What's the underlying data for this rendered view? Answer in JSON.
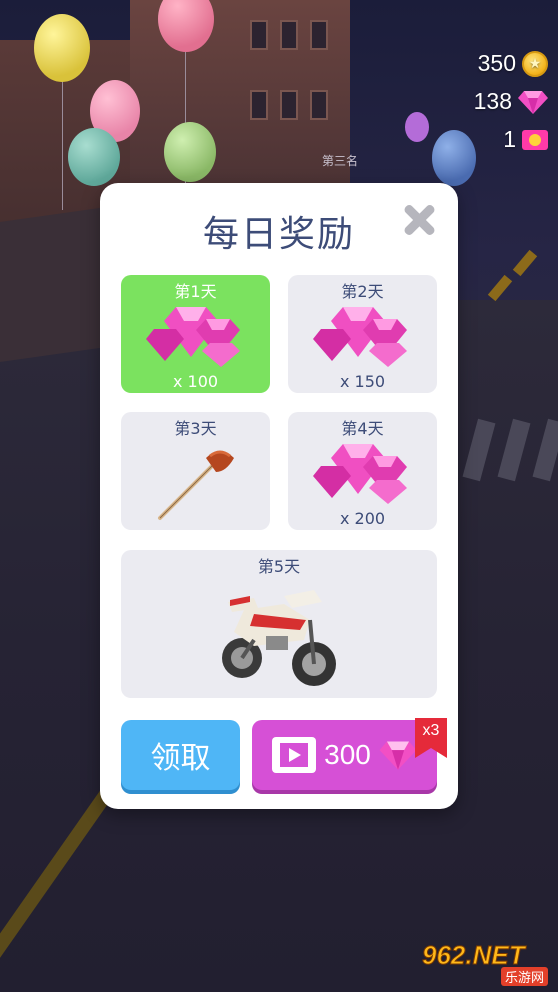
{
  "hud": {
    "coins": "350",
    "gems": "138",
    "tickets": "1",
    "coin_icon": "coin-icon",
    "gem_icon": "pink-gem-icon",
    "ticket_icon": "ticket-icon"
  },
  "scene": {
    "sign_text": "第三名"
  },
  "dialog": {
    "title": "每日奖励",
    "close_icon": "close-icon",
    "rewards": [
      {
        "day": "第1天",
        "qty": "x 100",
        "item": "gems",
        "claimed": true
      },
      {
        "day": "第2天",
        "qty": "x 150",
        "item": "gems",
        "claimed": false
      },
      {
        "day": "第3天",
        "qty": "",
        "item": "plunger",
        "claimed": false
      },
      {
        "day": "第4天",
        "qty": "x 200",
        "item": "gems",
        "claimed": false
      },
      {
        "day": "第5天",
        "qty": "",
        "item": "motorcycle",
        "claimed": false
      }
    ],
    "claim_label": "领取",
    "video_reward_amount": "300",
    "video_badge": "x3"
  },
  "watermark": {
    "brand": "962.NET",
    "sub": "乐游网"
  },
  "colors": {
    "claimed_card": "#7be25f",
    "card": "#ebebf1",
    "claim_button": "#4fb6f6",
    "video_button": "#d650d6",
    "title": "#3d4c78"
  }
}
